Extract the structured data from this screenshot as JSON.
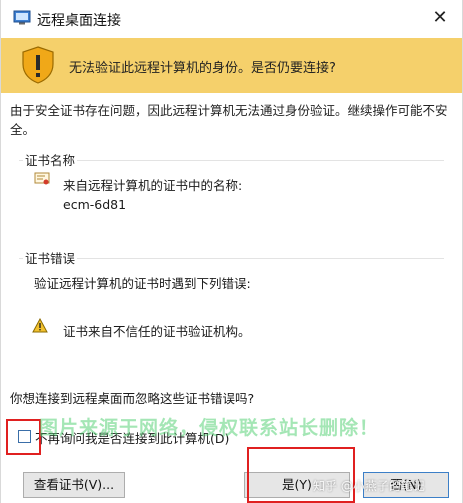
{
  "window": {
    "title": "远程桌面连接",
    "close_glyph": "✕"
  },
  "banner": {
    "text": "无法验证此远程计算机的身份。是否仍要连接?",
    "color": "#f5d06b"
  },
  "description": "由于安全证书存在问题，因此远程计算机无法通过身份验证。继续操作可能不安全。",
  "cert_name_section": {
    "title": "证书名称",
    "line1": "来自远程计算机的证书中的名称:",
    "line2": "ecm-6d81"
  },
  "cert_error_section": {
    "title": "证书错误",
    "line1": "验证远程计算机的证书时遇到下列错误:",
    "line2": "证书来自不信任的证书验证机构。"
  },
  "question": "你想连接到远程桌面而忽略这些证书错误吗?",
  "checkbox": {
    "label": "不再询问我是否连接到此计算机(D)",
    "checked": false
  },
  "buttons": {
    "view_cert": "查看证书(V)...",
    "yes": "是(Y)",
    "no": "否(N)"
  },
  "overlays": {
    "watermark": "图片来源于网络，侵权联系站长删除！",
    "zhihu": "知乎 @小燕子的笔记"
  },
  "icons": [
    "remote-desktop-icon",
    "shield-warning-icon",
    "certificate-icon",
    "warning-icon",
    "close-icon"
  ]
}
